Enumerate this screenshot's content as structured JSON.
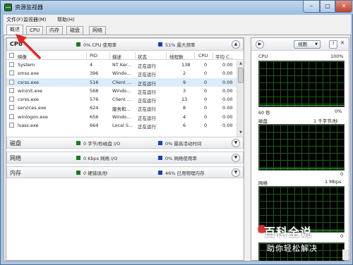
{
  "window": {
    "title": "资源监视器",
    "min": "–",
    "max": "□",
    "close": "✕"
  },
  "menu": [
    "文件(F)",
    "监视器(M)",
    "帮助(H)"
  ],
  "tabs": [
    "概述",
    "CPU",
    "内存",
    "磁盘",
    "网络"
  ],
  "cpu_section": {
    "title": "CPU",
    "usage": "0% CPU 使用率",
    "max_freq": "51% 最大频率",
    "usage_color": "#1b7a1b",
    "freq_color": "#1a3fbf"
  },
  "columns": [
    "映像",
    "PID",
    "描述",
    "状态",
    "线程数",
    "CPU",
    "平均 C..."
  ],
  "processes": [
    {
      "image": "System",
      "pid": "4",
      "desc": "NT Ker...",
      "status": "正在运行",
      "threads": "138",
      "cpu": "0",
      "avg": "0.00"
    },
    {
      "image": "smss.exe",
      "pid": "396",
      "desc": "Windo...",
      "status": "正在运行",
      "threads": "2",
      "cpu": "0",
      "avg": "0.00"
    },
    {
      "image": "csrss.exe",
      "pid": "516",
      "desc": "Client ...",
      "status": "正在运行",
      "threads": "9",
      "cpu": "0",
      "avg": "0.00"
    },
    {
      "image": "wininit.exe",
      "pid": "568",
      "desc": "Windo...",
      "status": "正在运行",
      "threads": "3",
      "cpu": "0",
      "avg": "0.00"
    },
    {
      "image": "csrss.exe",
      "pid": "576",
      "desc": "Client ...",
      "status": "正在运行",
      "threads": "13",
      "cpu": "0",
      "avg": "0.00"
    },
    {
      "image": "services.exe",
      "pid": "624",
      "desc": "服务和...",
      "status": "正在运行",
      "threads": "8",
      "cpu": "0",
      "avg": "0.00"
    },
    {
      "image": "winlogon.exe",
      "pid": "656",
      "desc": "Windo...",
      "status": "正在运行",
      "threads": "4",
      "cpu": "0",
      "avg": "0.00"
    },
    {
      "image": "lsass.exe",
      "pid": "664",
      "desc": "Local S...",
      "status": "正在运行",
      "threads": "6",
      "cpu": "0",
      "avg": "0.00"
    }
  ],
  "disk_section": {
    "title": "磁盘",
    "io": "0 字节/秒磁盘 I/O",
    "active": "0% 最高活动时间"
  },
  "network_section": {
    "title": "网络",
    "io": "0 Kbps 网络 I/O",
    "usage": "0% 网络使用率"
  },
  "memory_section": {
    "title": "内存",
    "faults": "0 硬错误/秒",
    "used": "46% 已用物理内存"
  },
  "right_panel": {
    "view_label": "视图",
    "help": "?",
    "cpu_graph": {
      "label": "CPU",
      "top": "100%",
      "bottom_left": "60 秒",
      "bottom_right": "0%"
    },
    "disk_graph": {
      "label": "磁盘",
      "top": "1 千字节/秒",
      "bottom_right": "0"
    },
    "network_graph": {
      "label": "网络",
      "top": "1 Mbps",
      "bottom_right": "0"
    }
  },
  "watermark": {
    "title": "百科全说",
    "subtitle": "助你轻松解决"
  },
  "colors": {
    "accent_red": "#e32626",
    "graph_green": "#34c534"
  }
}
